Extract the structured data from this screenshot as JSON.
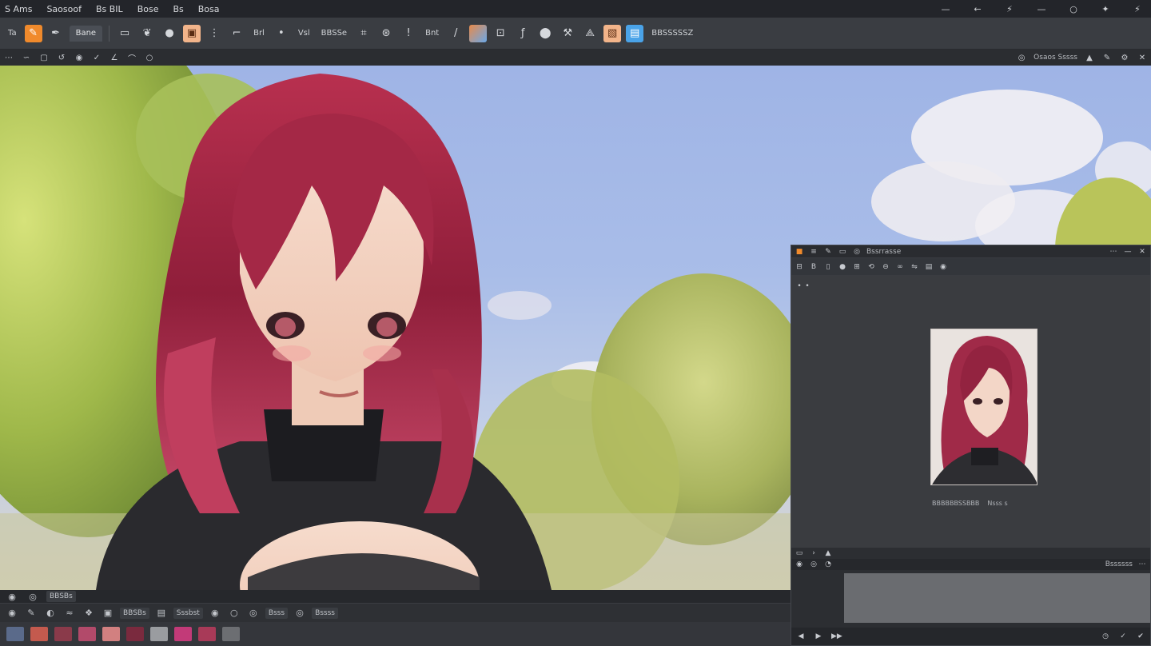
{
  "menubar": {
    "items": [
      "S Ams",
      "Saosoof",
      "Bs BIL",
      "Bose",
      "Bs",
      "Bosa"
    ],
    "window_controls": [
      "—",
      "←",
      "⚡",
      "—",
      "○",
      "✦",
      "⚡"
    ]
  },
  "toolbar": {
    "tabs": [
      "Ta",
      "Bane"
    ],
    "labels": [
      "Brl",
      "Vsl",
      "BBSSe",
      "Bnt"
    ],
    "right_label": "BBSSSSSZ",
    "icons": [
      "brush-icon",
      "pen-icon",
      "eraser-icon",
      "fill-icon",
      "select-icon",
      "move-icon",
      "eyedropper-icon",
      "lasso-icon",
      "text-icon",
      "gradient-icon",
      "shape-icon",
      "crop-icon",
      "zoom-icon",
      "hand-icon"
    ]
  },
  "optbar": {
    "right_label": "Osaos Sssss"
  },
  "navigator": {
    "title_label": "Bssrrasse",
    "caption_left": "BBBBBBSSBBB",
    "caption_right": "Nsss s",
    "footer_label": "Bssssss"
  },
  "bottom": {
    "row1_label": "BBSBs",
    "row2_labels": [
      "BBSBs",
      "Sssbst",
      "Bsss",
      "Bssss"
    ]
  },
  "colors": {
    "accent_orange": "#f08a2c",
    "accent_blue": "#4aa3e8",
    "panel_bg": "#2e3034",
    "toolbar_bg": "#3a3d42"
  }
}
